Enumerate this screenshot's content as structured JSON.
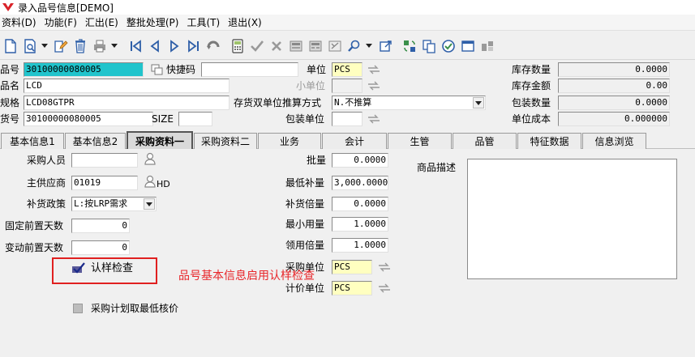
{
  "window": {
    "title": "录入品号信息[DEMO]"
  },
  "menu": [
    "资料(D)",
    "功能(F)",
    "汇出(E)",
    "整批处理(P)",
    "工具(T)",
    "退出(X)"
  ],
  "toolbar": {
    "icons": [
      "new-icon",
      "preview-icon",
      "edit-icon",
      "delete-icon",
      "print-icon",
      "first-icon",
      "prev-icon",
      "next-icon",
      "last-icon",
      "undo-icon",
      "calculator-icon",
      "confirm-icon",
      "cancel-icon",
      "form-icon",
      "form2-icon",
      "batch-icon",
      "search-icon",
      "export-icon",
      "refresh-icon",
      "copy-icon",
      "approve-icon",
      "window-icon",
      "layout-icon"
    ]
  },
  "header": {
    "item_no_label": "品号",
    "item_no": "30100000080005",
    "quick_code_label": "快捷码",
    "quick_code": "",
    "unit_label": "单位",
    "unit": "PCS",
    "stock_qty_label": "库存数量",
    "stock_qty": "0.0000",
    "name_label": "品名",
    "name": "LCD",
    "small_unit_label": "小单位",
    "small_unit": "",
    "stock_amount_label": "库存金额",
    "stock_amount": "0.00",
    "spec_label": "规格",
    "spec": "LCD08GTPR",
    "dual_unit_label": "存货双单位推算方式",
    "dual_unit": "N.不推算",
    "pack_qty_label": "包装数量",
    "pack_qty": "0.0000",
    "goods_no_label": "货号",
    "goods_no": "30100000080005",
    "size_label": "SIZE",
    "size": "",
    "pack_unit_label": "包装单位",
    "pack_unit": "",
    "unit_cost_label": "单位成本",
    "unit_cost": "0.000000"
  },
  "tabs": [
    "基本信息1",
    "基本信息2",
    "采购资料一",
    "采购资料二",
    "业务",
    "会计",
    "生管",
    "品管",
    "特征数据",
    "信息浏览"
  ],
  "purchase": {
    "buyer_label": "采购人员",
    "buyer": "",
    "supplier_label": "主供应商",
    "supplier": "01019",
    "supplier_suffix": "HD",
    "policy_label": "补货政策",
    "policy": "L:按LRP需求",
    "fixed_lead_label": "固定前置天数",
    "fixed_lead": "0",
    "var_lead_label": "变动前置天数",
    "var_lead": "0",
    "sample_check_label": "认样检查",
    "lowest_price_label": "采购计划取最低核价",
    "batch_label": "批量",
    "batch": "0.0000",
    "min_reorder_label": "最低补量",
    "min_reorder": "3,000.0000",
    "reorder_mult_label": "补货倍量",
    "reorder_mult": "0.0000",
    "min_use_label": "最小用量",
    "min_use": "1.0000",
    "issue_mult_label": "领用倍量",
    "issue_mult": "1.0000",
    "purchase_unit_label": "采购单位",
    "purchase_unit": "PCS",
    "price_unit_label": "计价单位",
    "price_unit": "PCS",
    "desc_label": "商品描述",
    "desc": ""
  },
  "annotation": "品号基本信息启用认样检查",
  "colors": {
    "cyan_field": "#21c4cc",
    "yellow_field": "#ffffc0",
    "annotation": "#e8262a"
  }
}
